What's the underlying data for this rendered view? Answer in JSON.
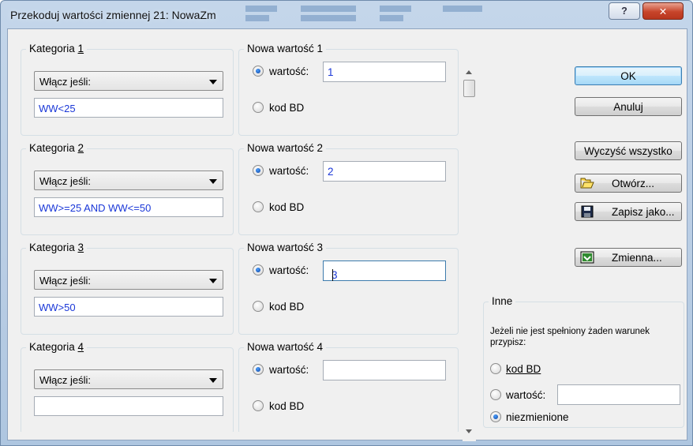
{
  "window": {
    "title": "Przekoduj wartości zmiennej 21: NowaZm",
    "help_label": "?",
    "close_label": "✕"
  },
  "categories": [
    {
      "label_prefix": "Kategoria ",
      "label_num": "1",
      "combo_value": "Włącz jeśli:",
      "expression": "WW<25",
      "new_label": "Nowa wartość 1",
      "value_label": "wartość:",
      "value": "1",
      "kod_label": "kod BD",
      "selected": "wartosc"
    },
    {
      "label_prefix": "Kategoria ",
      "label_num": "2",
      "combo_value": "Włącz jeśli:",
      "expression": "WW>=25 AND WW<=50",
      "new_label": "Nowa wartość 2",
      "value_label": "wartość:",
      "value": "2",
      "kod_label": "kod BD",
      "selected": "wartosc"
    },
    {
      "label_prefix": "Kategoria ",
      "label_num": "3",
      "combo_value": "Włącz jeśli:",
      "expression": "WW>50",
      "new_label": "Nowa wartość 3",
      "value_label": "wartość:",
      "value": "3",
      "kod_label": "kod BD",
      "selected": "wartosc"
    },
    {
      "label_prefix": "Kategoria ",
      "label_num": "4",
      "combo_value": "Włącz jeśli:",
      "expression": "",
      "new_label": "Nowa wartość 4",
      "value_label": "wartość:",
      "value": "",
      "kod_label": "kod BD",
      "selected": "wartosc"
    }
  ],
  "buttons": {
    "ok": "OK",
    "cancel": "Anuluj",
    "clear_all": "Wyczyść wszystko",
    "open": "Otwórz...",
    "save_as": "Zapisz jako...",
    "variable": "Zmienna..."
  },
  "inne": {
    "title": "Inne",
    "description": "Jeżeli nie jest spełniony żaden warunek przypisz:",
    "kod_label": "kod BD",
    "value_label": "wartość:",
    "value": "",
    "unchanged_label": "niezmienione",
    "selected": "niezmienione"
  },
  "colors": {
    "expression_text": "#1b38d8",
    "title_gradient_top": "#c4d6ea",
    "close_button": "#c7442a"
  },
  "icons": {
    "open": "folder-open-icon",
    "save": "floppy-disk-icon",
    "variable": "variable-icon"
  }
}
